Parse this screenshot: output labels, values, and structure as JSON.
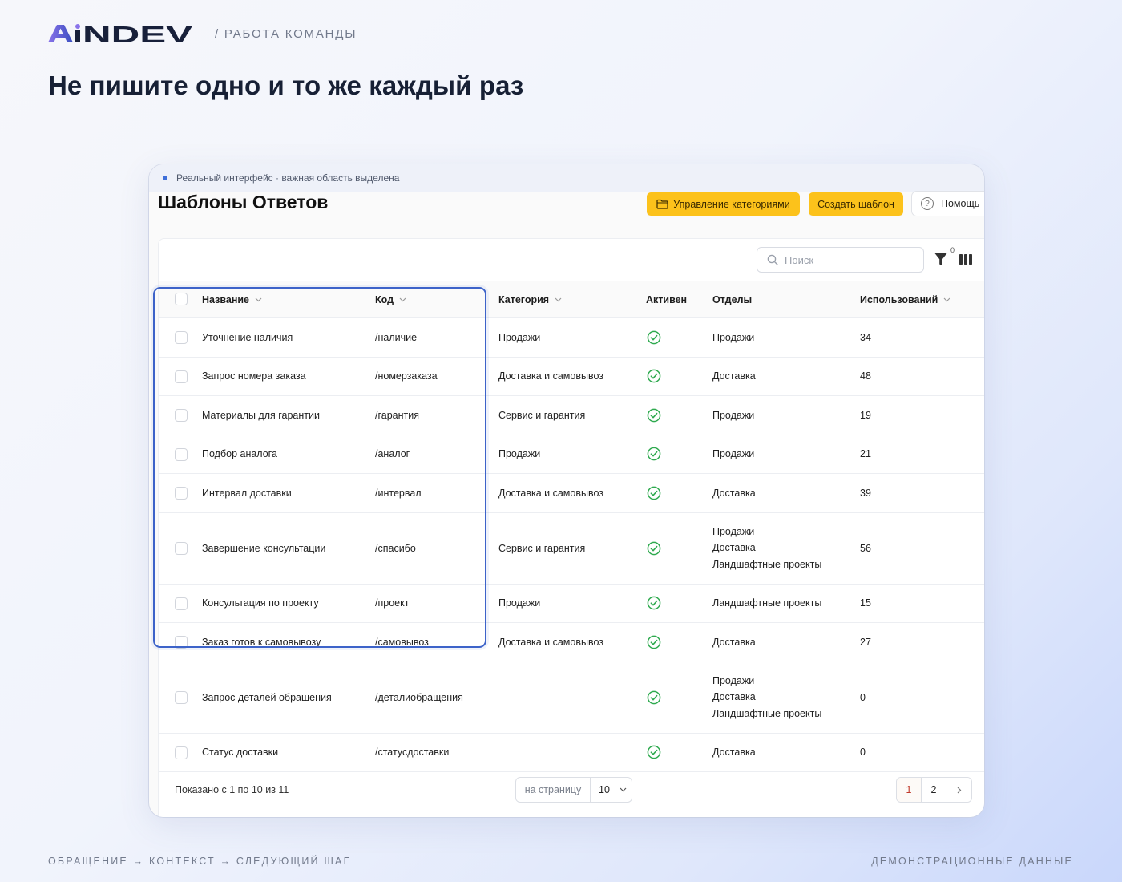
{
  "brand": {
    "logo_text": "AiNDEV",
    "logo_colors": {
      "primary": "#18203a",
      "accent_gradient_start": "#8a73ea",
      "accent_gradient_end": "#3a4fc0"
    },
    "breadcrumb": "/ РАБОТА КОМАНДЫ"
  },
  "headline": "Не пишите одно и то же каждый раз",
  "notice": "Реальный интерфейс · важная область выделена",
  "page_title": "Шаблоны Ответов",
  "toolbar": {
    "manage_categories": "Управление категориями",
    "create_template": "Создать шаблон",
    "help": "Помощь"
  },
  "search": {
    "placeholder": "Поиск"
  },
  "filter": {
    "count": "0"
  },
  "columns": {
    "name": "Название",
    "code": "Код",
    "category": "Категория",
    "active": "Активен",
    "departments": "Отделы",
    "usage": "Использований"
  },
  "rows": [
    {
      "name": "Уточнение наличия",
      "code": "/наличие",
      "category": "Продажи",
      "active": true,
      "departments": [
        "Продажи"
      ],
      "usage": "34"
    },
    {
      "name": "Запрос номера заказа",
      "code": "/номерзаказа",
      "category": "Доставка и самовывоз",
      "active": true,
      "departments": [
        "Доставка"
      ],
      "usage": "48"
    },
    {
      "name": "Материалы для гарантии",
      "code": "/гарантия",
      "category": "Сервис и гарантия",
      "active": true,
      "departments": [
        "Продажи"
      ],
      "usage": "19"
    },
    {
      "name": "Подбор аналога",
      "code": "/аналог",
      "category": "Продажи",
      "active": true,
      "departments": [
        "Продажи"
      ],
      "usage": "21"
    },
    {
      "name": "Интервал доставки",
      "code": "/интервал",
      "category": "Доставка и самовывоз",
      "active": true,
      "departments": [
        "Доставка"
      ],
      "usage": "39"
    },
    {
      "name": "Завершение консультации",
      "code": "/спасибо",
      "category": "Сервис и гарантия",
      "active": true,
      "departments": [
        "Продажи",
        "Доставка",
        "Ландшафтные проекты"
      ],
      "usage": "56"
    },
    {
      "name": "Консультация по проекту",
      "code": "/проект",
      "category": "Продажи",
      "active": true,
      "departments": [
        "Ландшафтные проекты"
      ],
      "usage": "15"
    },
    {
      "name": "Заказ готов к самовывозу",
      "code": "/самовывоз",
      "category": "Доставка и самовывоз",
      "active": true,
      "departments": [
        "Доставка"
      ],
      "usage": "27"
    },
    {
      "name": "Запрос деталей обращения",
      "code": "/деталиобращения",
      "category": "",
      "active": true,
      "departments": [
        "Продажи",
        "Доставка",
        "Ландшафтные проекты"
      ],
      "usage": "0"
    },
    {
      "name": "Статус доставки",
      "code": "/статусдоставки",
      "category": "",
      "active": true,
      "departments": [
        "Доставка"
      ],
      "usage": "0"
    }
  ],
  "pagination": {
    "summary": "Показано с 1 по 10 из 11",
    "per_page_label": "на страницу",
    "per_page_value": "10",
    "pages": [
      "1",
      "2"
    ],
    "current_page": "1"
  },
  "footer": {
    "left": "ОБРАЩЕНИЕ → КОНТЕКСТ → СЛЕДУЮЩИЙ ШАГ",
    "right": "ДЕМОНСТРАЦИОННЫЕ ДАННЫЕ"
  },
  "colors": {
    "accent_yellow": "#fcc21b",
    "highlight_blue": "#3d63c9",
    "active_green": "#2faa4f",
    "notice_dot": "#3f6fd9"
  },
  "icons": {
    "folder": "folder-icon",
    "help": "help-circle-icon",
    "search": "search-icon",
    "filter": "filter-icon",
    "columns": "columns-icon",
    "active": "check-circle-icon",
    "sort": "chevron-down-icon",
    "next_page": "chevron-right-icon"
  }
}
